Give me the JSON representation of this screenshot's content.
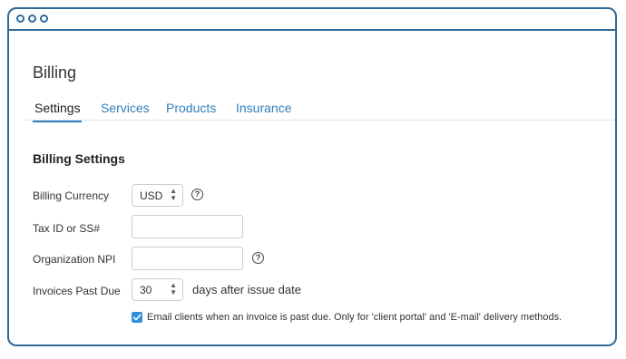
{
  "page": {
    "title": "Billing"
  },
  "tabs": [
    {
      "label": "Settings",
      "active": true
    },
    {
      "label": "Services",
      "active": false
    },
    {
      "label": "Products",
      "active": false
    },
    {
      "label": "Insurance",
      "active": false
    }
  ],
  "section": {
    "title": "Billing Settings"
  },
  "fields": {
    "currency": {
      "label": "Billing Currency",
      "value": "USD"
    },
    "tax_id": {
      "label": "Tax ID or SS#",
      "value": ""
    },
    "npi": {
      "label": "Organization NPI",
      "value": ""
    },
    "past_due": {
      "label": "Invoices Past Due",
      "value": "30",
      "suffix": "days after issue date"
    }
  },
  "email_option": {
    "checked": true,
    "label": "Email clients when an invoice is past due. Only for 'client portal' and 'E-mail' delivery methods."
  },
  "icons": {
    "help": "question-circle-icon",
    "window_controls": "circle-icon"
  },
  "colors": {
    "accent": "#2f7fbf",
    "window_border": "#2d6a9a",
    "checkbox": "#2f8fd8"
  }
}
